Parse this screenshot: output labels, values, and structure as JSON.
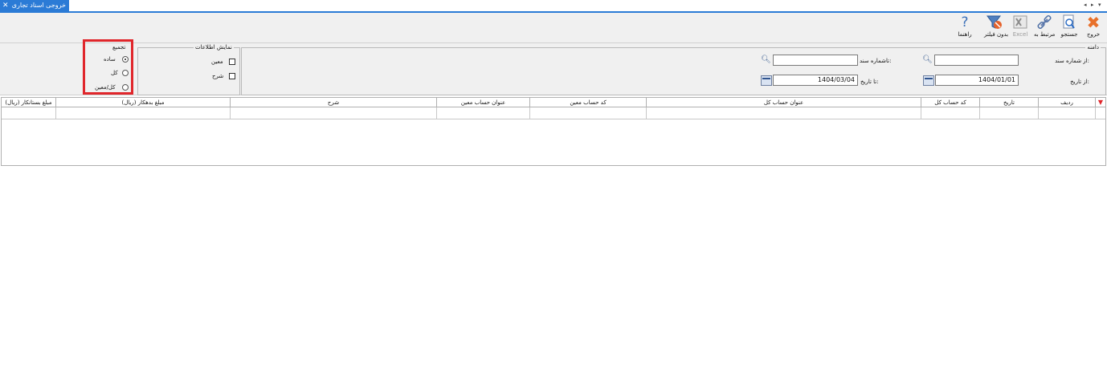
{
  "tab": {
    "title": "خروجی اسناد تجاری",
    "close_glyph": "✕"
  },
  "tabbar_nav": {
    "prev": "◂",
    "next": "▸",
    "menu": "▾"
  },
  "toolbar": {
    "exit_label": "خروج",
    "search_label": "جستجو",
    "related_label": "مرتبط به",
    "excel_label": "Excel",
    "nofilter_label": "بدون فیلتر",
    "help_label": "راهنما",
    "help_glyph": "?"
  },
  "range_group": {
    "title": "دامنه",
    "from_doc_label": "از شماره سند:",
    "from_doc_value": "",
    "to_doc_label": "تاشماره سند:",
    "to_doc_value": "",
    "from_date_label": "از تاریخ:",
    "from_date_value": "1404/01/01",
    "to_date_label": "تا تاریخ:",
    "to_date_value": "1404/03/04"
  },
  "display_group": {
    "title": "نمایش اطلاعات",
    "moein_label": "معین",
    "moein_checked": false,
    "sharh_label": "شرح",
    "sharh_checked": false
  },
  "aggregation_group": {
    "title": "تجمیع",
    "options": [
      "ساده",
      "کل",
      "کل/معین"
    ],
    "selected": "ساده"
  },
  "grid": {
    "columns": [
      "ردیف",
      "تاریخ",
      "کد حساب کل",
      "عنوان حساب کل",
      "کد حساب معین",
      "عنوان حساب معین",
      "شرح",
      "مبلغ بدهکار (ریال)",
      "مبلغ بستانکار (ریال)"
    ],
    "rows": []
  },
  "colors": {
    "accent": "#2b7bd6",
    "highlight": "#e0262b",
    "panel": "#f0f0f0"
  }
}
